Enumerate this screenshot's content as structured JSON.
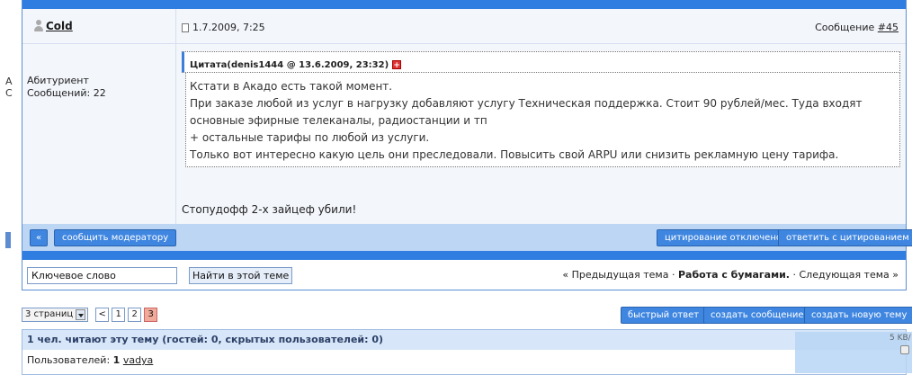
{
  "left_edge": {
    "chars": [
      "А",
      "С"
    ]
  },
  "post": {
    "author": "Cold",
    "date": "1.7.2009, 7:25",
    "post_number_label": "Сообщение",
    "post_number": "#45",
    "user_rank": "Абитуриент",
    "user_posts": "Сообщений: 22",
    "quote_header": "Цитата(denis1444 @ 13.6.2009, 23:32)",
    "quote_lines": [
      "Кстати в Акадо есть такой момент.",
      "При заказе любой из услуг в нагрузку добавляют услугу Техническая поддержка. Стоит 90 рублей/мес. Туда входят",
      "основные эфирные телеканалы, радиостанции и тп",
      "+ остальные тарифы по любой из услуги.",
      "Только вот интересно какую цель они преследовали. Повысить свой ARPU или снизить рекламную цену тарифа."
    ],
    "reply_text": "Стопудофф 2-х зайцеф убили!",
    "buttons": {
      "report": "сообщить модератору",
      "quote_disabled": "цитирование отключено",
      "reply_quote": "ответить с цитированием"
    }
  },
  "search": {
    "value": "Ключевое слово",
    "button": "Найти в этой теме"
  },
  "topic_nav": {
    "prev": "« Предыдущая тема",
    "sep1": " · ",
    "current": "Работа с бумагами.",
    "sep2": " · ",
    "next": "Следующая тема »"
  },
  "pager": {
    "dropdown": "3 страниц",
    "prev": "<",
    "pages": [
      "1",
      "2",
      "3"
    ],
    "active_page": "3"
  },
  "actions": {
    "fast_reply": "быстрый ответ",
    "new_post": "создать сообщение",
    "new_topic": "создать новую тему"
  },
  "readers": {
    "header": "1 чел. читают эту тему (гостей: 0, скрытых пользователей: 0)",
    "users_label": "Пользователей:",
    "users_count": "1",
    "user": "vadya"
  },
  "widget": {
    "label": "5 KB/"
  }
}
